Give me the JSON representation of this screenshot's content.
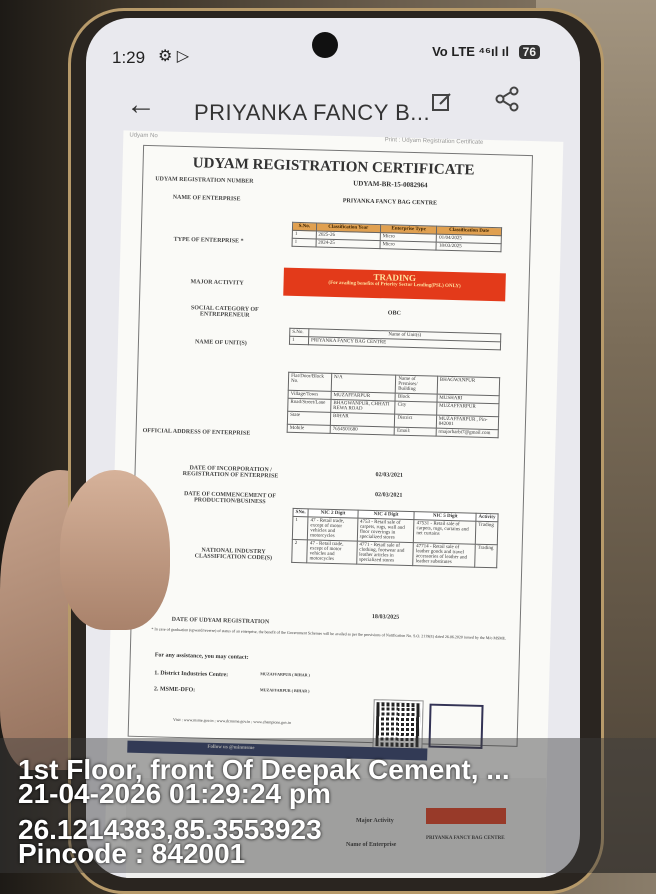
{
  "status_bar": {
    "time": "1:29",
    "left_icons": "⚙ ▷",
    "right_icons": "Vo LTE ⁴⁶ıl ıl",
    "battery": "76"
  },
  "app_bar": {
    "title": "PRIYANKA FANCY B...",
    "back_icon": "arrow-left-icon",
    "edit_icon": "edit-icon",
    "share_icon": "share-icon"
  },
  "document": {
    "top_left": "Udyam No",
    "top_right": "Print : Udyam Registration Certificate",
    "title": "UDYAM REGISTRATION CERTIFICATE",
    "reg_number_label": "UDYAM REGISTRATION NUMBER",
    "reg_number": "UDYAM-BR-15-0082964",
    "name_label": "NAME OF ENTERPRISE",
    "name": "PRIYANKA FANCY BAG CENTRE",
    "type_label": "TYPE OF ENTERPRISE *",
    "classification": {
      "headers": [
        "S.No.",
        "Classification Year",
        "Enterprise Type",
        "Classification Date"
      ],
      "rows": [
        [
          "1",
          "2025-26",
          "Micro",
          "01/04/2025"
        ],
        [
          "1",
          "2024-25",
          "Micro",
          "18/03/2025"
        ]
      ]
    },
    "activity_label": "MAJOR ACTIVITY",
    "activity": "TRADING",
    "activity_note": "(For availing benefits of Priority Sector Lending(PSL) ONLY)",
    "social_label": "SOCIAL CATEGORY OF ENTREPRENEUR",
    "social": "OBC",
    "units_label": "NAME OF UNIT(S)",
    "units": {
      "headers": [
        "S.No.",
        "Name of Unit(s)"
      ],
      "rows": [
        [
          "1",
          "PRIYANKA FANCY BAG CENTRE"
        ]
      ]
    },
    "address_label": "OFFICIAL ADDRESS OF ENTERPRISE",
    "address": [
      [
        "Flat/Door/Block No.",
        "N/A",
        "Name of Premises/ Building",
        "BHAGWANPUR"
      ],
      [
        "Village/Town",
        "MUZAFFARPUR",
        "Block",
        "MUSHARI"
      ],
      [
        "Road/Street/Lane",
        "BHAGWANPUR, CHHATI REWA ROAD",
        "City",
        "MUZAFFARPUR"
      ],
      [
        "State",
        "BIHAR",
        "District",
        "MUZAFFARPUR , Pin-842001"
      ],
      [
        "Mobile",
        "7654501680",
        "Email:",
        "rmajorbarbi7@gmail.com"
      ]
    ],
    "incorporation_label": "DATE OF INCORPORATION / REGISTRATION OF ENTERPRISE",
    "incorporation": "02/03/2021",
    "commencement_label": "DATE OF COMMENCEMENT OF PRODUCTION/BUSINESS",
    "commencement": "02/03/2021",
    "nic_label": "NATIONAL INDUSTRY CLASSIFICATION CODE(S)",
    "nic": {
      "headers": [
        "SNo.",
        "NIC 2 Digit",
        "NIC 4 Digit",
        "NIC 5 Digit",
        "Activity"
      ],
      "rows": [
        [
          "1",
          "47 - Retail trade, except of motor vehicles and motorcycles",
          "4753 - Retail sale of carpets, rugs, wall and floor coverings in specialized stores",
          "47531 - Retail sale of carpets, rugs, curtains and net curtains",
          "Trading"
        ],
        [
          "2",
          "47 - Retail trade, except of motor vehicles and motorcycles",
          "4771 - Retail sale of clothing, footwear and leather articles in specialized stores",
          "47714 - Retail sale of leather goods and travel accessories of leather and leather substitutes",
          "Trading"
        ]
      ]
    },
    "udyam_date_label": "DATE OF UDYAM REGISTRATION",
    "udyam_date": "18/03/2025",
    "fine_print": "* In case of graduation (upward/reverse) of status of an enterprise, the benefit of the Government Schemes will be availed as per the provisions of Notification No. S.O. 2119(E) dated 26.06.2020 issued by the M/o MSME.",
    "assistance": "For any assistance, you may contact:",
    "contact1_label": "1. District Industries Centre:",
    "contact1": "MUZAFFARPUR ( BIHAR )",
    "contact2_label": "2. MSME-DFO:",
    "contact2": "MUZAFFARPUR ( BIHAR )",
    "visit": "Visit : www.msme.gov.in ; www.dcmsme.gov.in ; www.champions.gov.in",
    "follow": "Follow us @minmsme"
  },
  "lower_doc": {
    "major_activity": "Major Activity",
    "name_label": "Name of Enterprise",
    "name": "PRIYANKA FANCY BAG CENTRE"
  },
  "overlay": {
    "line1": "1st Floor, front Of Deepak Cement, ...",
    "line2": "21-04-2026 01:29:24 pm",
    "line3": "26.1214383,85.3553923",
    "line4": "Pincode : 842001"
  }
}
